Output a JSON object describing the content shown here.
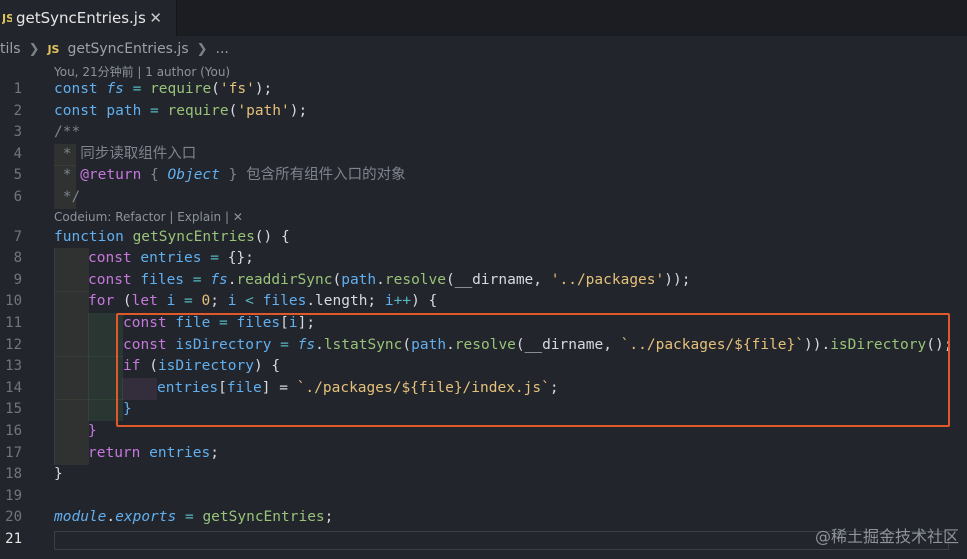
{
  "tab": {
    "icon": "JS",
    "label": "getSyncEntries.js",
    "close": "✕"
  },
  "breadcrumb": {
    "folder": "tils",
    "icon": "JS",
    "file": "getSyncEntries.js",
    "more": "..."
  },
  "lens": {
    "blame": "You, 21分钟前 | 1 author (You)",
    "codeium": "Codeium: Refactor | Explain | ✕"
  },
  "line_numbers": [
    "1",
    "2",
    "3",
    "4",
    "5",
    "6",
    "7",
    "8",
    "9",
    "10",
    "11",
    "12",
    "13",
    "14",
    "15",
    "16",
    "17",
    "18",
    "19",
    "20",
    "21"
  ],
  "code": {
    "l1": [
      "const ",
      "fs",
      " = ",
      "require",
      "(",
      "'fs'",
      ");"
    ],
    "l2": [
      "const ",
      "path",
      " = ",
      "require",
      "(",
      "'path'",
      ");"
    ],
    "l3": [
      "/**"
    ],
    "l4": [
      " * 同步读取组件入口"
    ],
    "l5": [
      " * ",
      "@return",
      " { ",
      "Object",
      " } 包含所有组件入口的对象"
    ],
    "l6": [
      " */"
    ],
    "l7": [
      "function ",
      "getSyncEntries",
      "() {"
    ],
    "l8": [
      "const ",
      "entries",
      " = ",
      "{};"
    ],
    "l9": [
      "const ",
      "files",
      " = ",
      "fs",
      ".",
      "readdirSync",
      "(",
      "path",
      ".",
      "resolve",
      "(__dirname, ",
      "'../packages'",
      "));"
    ],
    "l10": [
      "for ",
      "(",
      "let ",
      "i",
      " = ",
      "0",
      "; ",
      "i",
      " < ",
      "files",
      ".length; ",
      "i",
      "++",
      ") {"
    ],
    "l11": [
      "const ",
      "file",
      " = ",
      "files",
      "[",
      "i",
      "];"
    ],
    "l12": [
      "const ",
      "isDirectory",
      " = ",
      "fs",
      ".",
      "lstatSync",
      "(",
      "path",
      ".",
      "resolve",
      "(__dirname, ",
      "`../packages/${file}`",
      ")).",
      "isDirectory",
      "();"
    ],
    "l13": [
      "if ",
      "(",
      "isDirectory",
      ") {"
    ],
    "l14": [
      "entries",
      "[",
      "file",
      "] = ",
      "`./packages/${file}/index.js`",
      ";"
    ],
    "l15": [
      "}"
    ],
    "l16": [
      "}"
    ],
    "l17": [
      "return ",
      "entries",
      ";"
    ],
    "l18": [
      ""
    ],
    "l19": [
      "}"
    ],
    "l20": [
      "module",
      ".",
      "exports",
      " = ",
      "getSyncEntries",
      ";"
    ],
    "l21": [
      ""
    ]
  },
  "watermark": "@稀土掘金技术社区",
  "colors": {
    "background": "#22252b",
    "keyword": "#c678dd",
    "identifier": "#61afef",
    "function": "#98c379",
    "string": "#e5c07b",
    "operator": "#56b6c2",
    "comment": "#7f848e",
    "highlight_border": "#e0592a"
  }
}
